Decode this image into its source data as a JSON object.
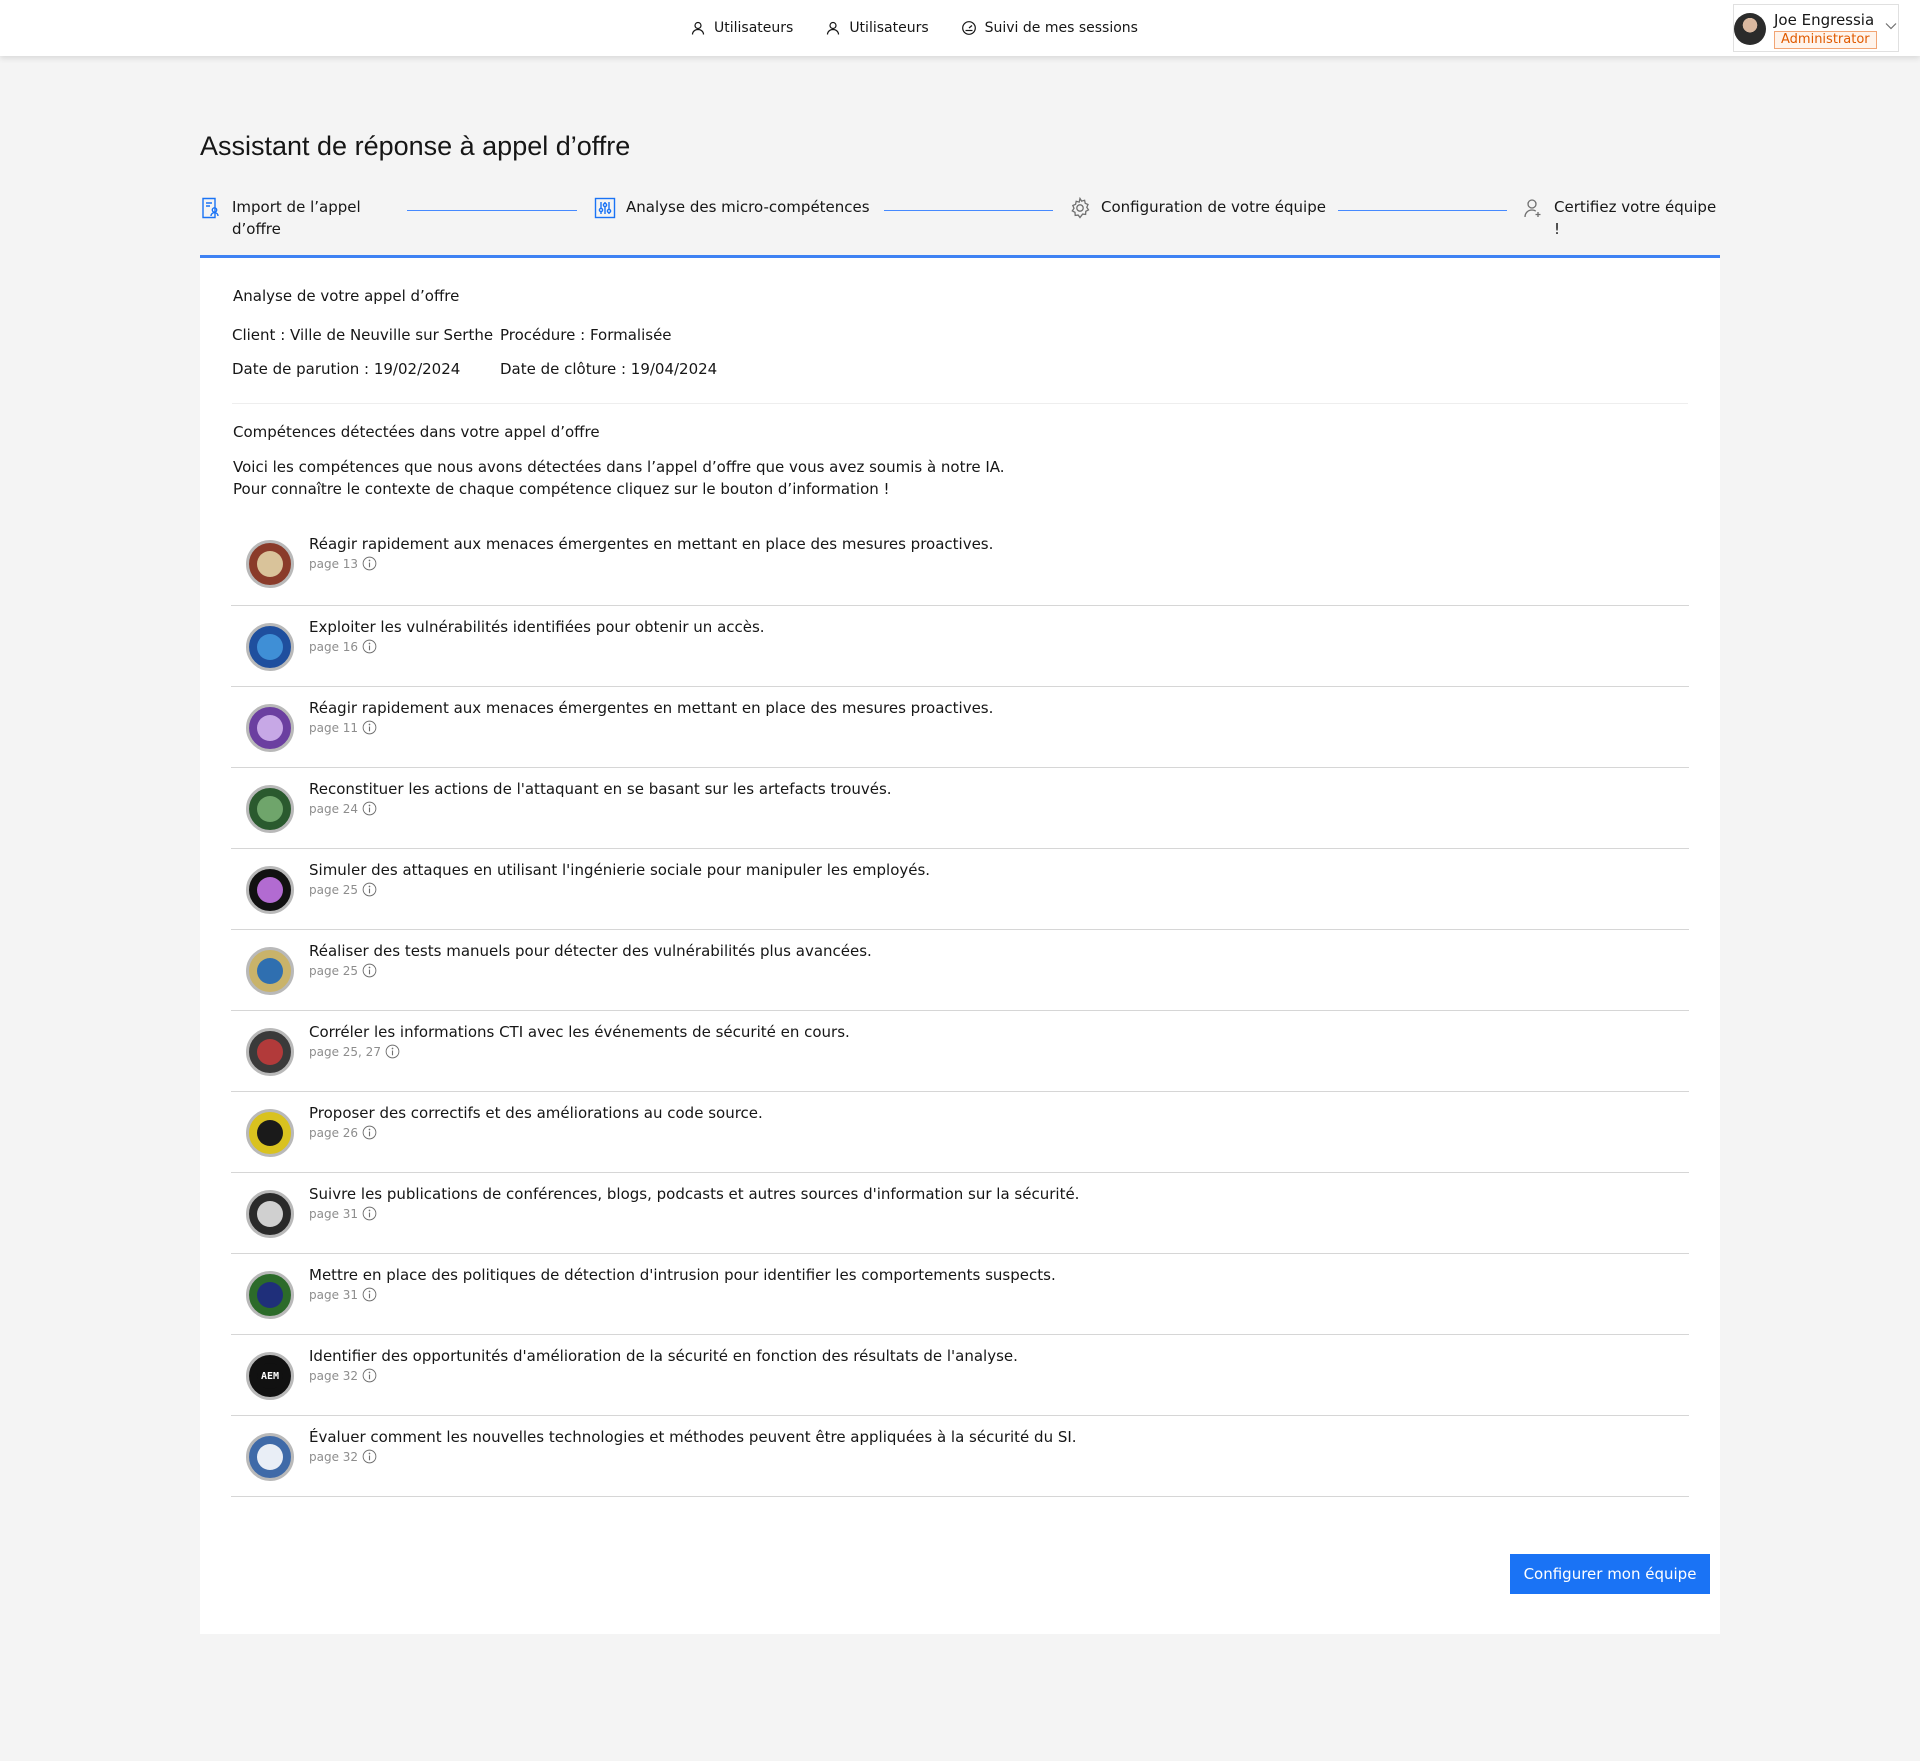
{
  "topnav": {
    "items": [
      {
        "label": "Utilisateurs",
        "icon": "user-icon"
      },
      {
        "label": "Utilisateurs",
        "icon": "user-icon"
      },
      {
        "label": "Suivi de mes sessions",
        "icon": "dashboard-icon"
      }
    ]
  },
  "user": {
    "name": "Joe Engressia",
    "role": "Administrator"
  },
  "page": {
    "title": "Assistant de réponse à appel d’offre"
  },
  "stepper": {
    "steps": [
      {
        "label_line1": "Import de l’appel",
        "label_line2": "d’offre",
        "icon": "document-user-icon"
      },
      {
        "label_line1": "Analyse des micro-compétences",
        "label_line2": "",
        "icon": "sliders-icon"
      },
      {
        "label_line1": "Configuration de votre équipe",
        "label_line2": "",
        "icon": "gear-icon"
      },
      {
        "label_line1": "Certifiez votre équipe !",
        "label_line2": "",
        "icon": "user-add-icon"
      }
    ],
    "active_step": 2
  },
  "analysis": {
    "title": "Analyse de votre appel d’offre",
    "client": "Client : Ville de Neuville sur Serthe",
    "procedure": "Procédure : Formalisée",
    "publication_date": "Date de parution : 19/02/2024",
    "closing_date": "Date de clôture : 19/04/2024"
  },
  "skills_section": {
    "title": "Compétences détectées dans votre appel d’offre",
    "intro_line1": "Voici les compétences que nous avons détectées dans l’appel d’offre que vous avez soumis à notre IA.",
    "intro_line2": "Pour connaître le contexte de chaque compétence cliquez sur le bouton d’information !"
  },
  "skills": [
    {
      "text": "Réagir rapidement aux menaces émergentes en mettant en place des mesures proactives.",
      "page": "page 13",
      "badge_color": "#8a3b2a",
      "badge_inner": "#d9c39a"
    },
    {
      "text": "Exploiter les vulnérabilités identifiées pour obtenir un accès.",
      "page": "page 16",
      "badge_color": "#1f4f9e",
      "badge_inner": "#3f8fd6"
    },
    {
      "text": "Réagir rapidement aux menaces émergentes en mettant en place des mesures proactives.",
      "page": "page 11",
      "badge_color": "#6b3fa0",
      "badge_inner": "#c7a8e6"
    },
    {
      "text": "Reconstituer les actions de l'attaquant en se basant sur les artefacts trouvés.",
      "page": "page 24",
      "badge_color": "#2a5a2e",
      "badge_inner": "#6fa56b"
    },
    {
      "text": "Simuler des attaques en utilisant l'ingénierie sociale pour manipuler les employés.",
      "page": "page 25",
      "badge_color": "#111111",
      "badge_inner": "#b26bd1"
    },
    {
      "text": "Réaliser des tests manuels pour détecter des vulnérabilités plus avancées.",
      "page": "page 25",
      "badge_color": "#c9b36a",
      "badge_inner": "#2f6fb0"
    },
    {
      "text": "Corréler les informations CTI avec les événements de sécurité en cours.",
      "page": "page 25, 27",
      "badge_color": "#3a3a3a",
      "badge_inner": "#b23a3a"
    },
    {
      "text": "Proposer des correctifs et des améliorations au code source.",
      "page": "page 26",
      "badge_color": "#d9c21f",
      "badge_inner": "#1a1a1a"
    },
    {
      "text": "Suivre les publications de conférences, blogs, podcasts et autres sources d'information sur la sécurité.",
      "page": "page 31",
      "badge_color": "#2a2a2a",
      "badge_inner": "#d0d0d0"
    },
    {
      "text": "Mettre en place des politiques de détection d'intrusion pour identifier les comportements suspects.",
      "page": "page 31",
      "badge_color": "#2c6b2a",
      "badge_inner": "#1f2f7a"
    },
    {
      "text": "Identifier des opportunités d'amélioration de la sécurité en fonction des résultats de l'analyse.",
      "page": "page 32",
      "badge_color": "#111111",
      "badge_inner": "#111111",
      "badge_text": "AEM"
    },
    {
      "text": "Évaluer comment les nouvelles technologies et méthodes peuvent être appliquées à la sécurité du SI.",
      "page": "page 32",
      "badge_color": "#3f6aa8",
      "badge_inner": "#e9eef6"
    }
  ],
  "actions": {
    "configure_label": "Configurer mon équipe"
  },
  "colors": {
    "accent": "#1a73f5",
    "stepper_line": "#4589ff",
    "role_badge": "#e05a00"
  }
}
